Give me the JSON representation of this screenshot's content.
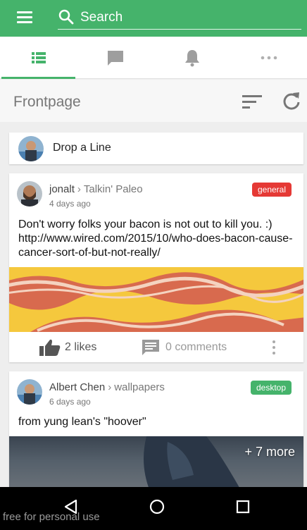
{
  "search": {
    "placeholder": "Search"
  },
  "tabs": [
    {
      "name": "feed-list-icon",
      "active": true
    },
    {
      "name": "chat-icon",
      "active": false
    },
    {
      "name": "bell-icon",
      "active": false
    },
    {
      "name": "more-dots-icon",
      "active": false
    }
  ],
  "header": {
    "title": "Frontpage"
  },
  "drop_line": {
    "label": "Drop a Line"
  },
  "posts": [
    {
      "author": "jonalt",
      "group": "Talkin' Paleo",
      "time": "4 days ago",
      "tag": "general",
      "text": "Don't worry folks your bacon is not out to kill you. :) http://www.wired.com/2015/10/who-does-bacon-cause-cancer-sort-of-but-not-really/",
      "likes": "2 likes",
      "comments": "0 comments"
    },
    {
      "author": "Albert Chen",
      "group": "wallpapers",
      "time": "6 days ago",
      "tag": "desktop",
      "text": "from yung lean's \"hoover\"",
      "more_photos": "+ 7 more"
    }
  ],
  "colors": {
    "accent": "#45b36b",
    "tag_red": "#e53935"
  },
  "watermark": "free for personal use"
}
